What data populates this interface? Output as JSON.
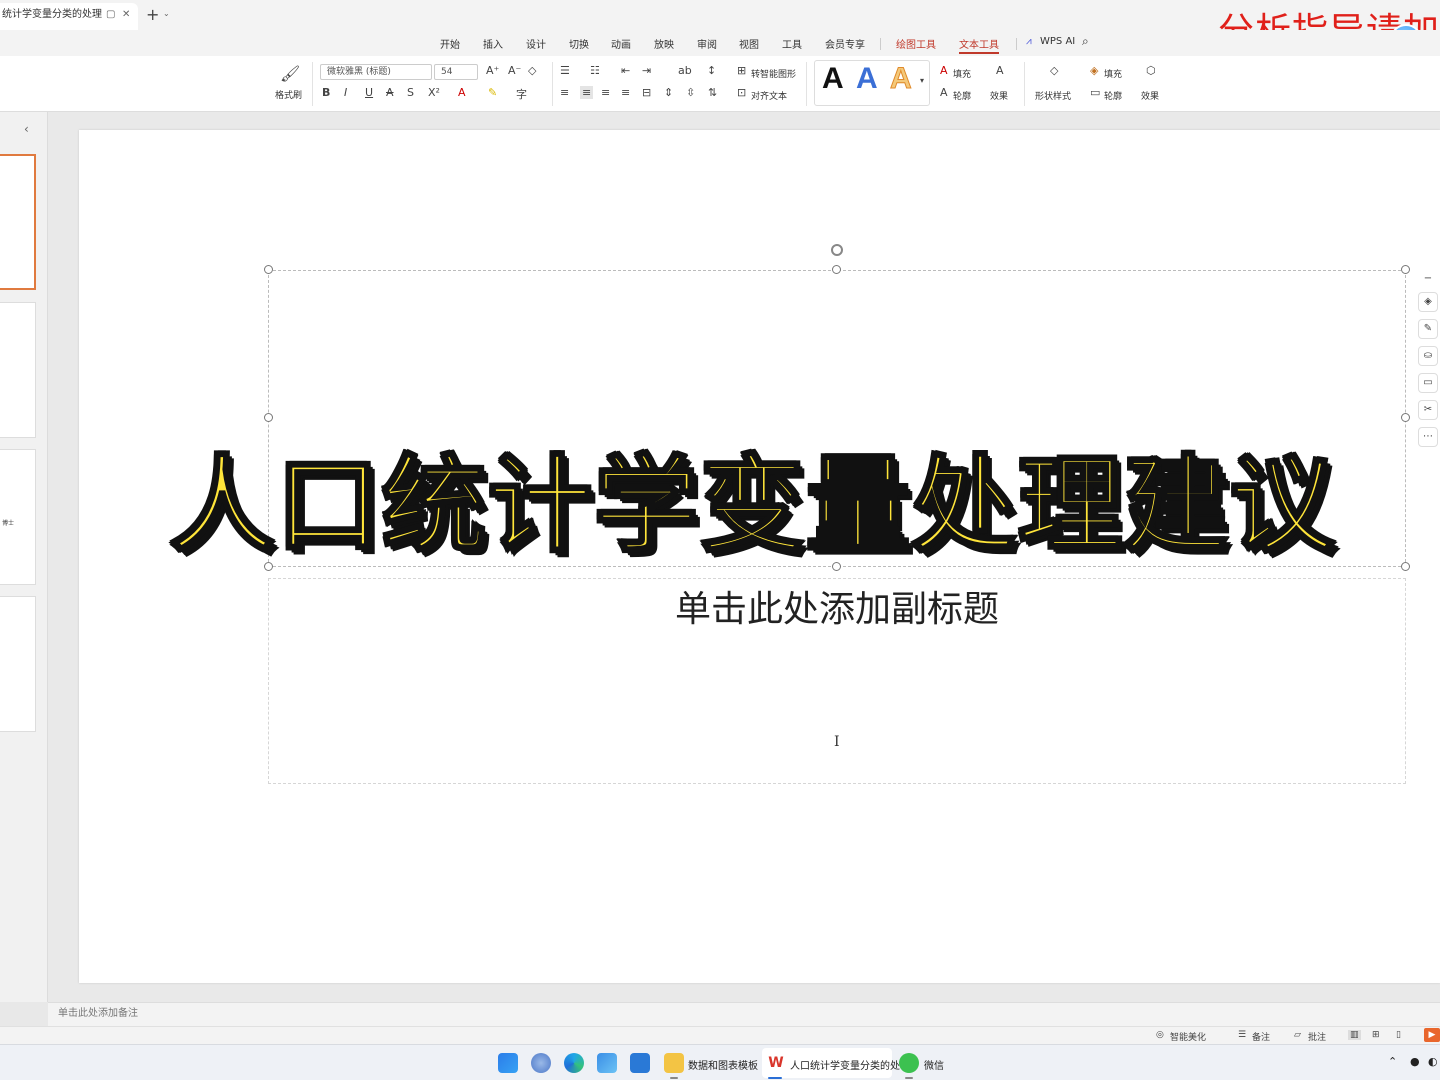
{
  "titlebar": {
    "doc_tab": "统计学变量分类的处理建",
    "new_tab": "+",
    "watermark": "分析指导请加"
  },
  "menu": {
    "items": [
      "开始",
      "插入",
      "设计",
      "切换",
      "动画",
      "放映",
      "审阅",
      "视图",
      "工具",
      "会员专享",
      "绘图工具",
      "文本工具",
      "WPS AI"
    ]
  },
  "ribbon": {
    "format_painter": "格式刷",
    "font_name": "微软雅黑 (标题)",
    "font_size": "54",
    "bold": "B",
    "italic": "I",
    "underline": "U",
    "strike": "S",
    "shadow_s": "S",
    "superscript": "X²",
    "smart_shape": "转智能图形",
    "align_text": "对齐文本",
    "fill1": "填充",
    "outline1": "轮廓",
    "effect1": "效果",
    "shape_style": "形状样式",
    "fill2": "填充",
    "outline2": "轮廓",
    "effect2": "效果",
    "sample_A": "A"
  },
  "slide": {
    "title": "人口统计学变量处理建议",
    "subtitle": "单击此处添加副标题"
  },
  "thumbnails": {
    "slide3_text": "博士"
  },
  "notes": {
    "placeholder": "单击此处添加备注"
  },
  "statusbar": {
    "beautify": "智能美化",
    "notes": "备注",
    "comment": "批注"
  },
  "taskbar": {
    "folder_label": "数据和图表模板",
    "wps_label": "人口统计学变量分类的处",
    "wechat_label": "微信"
  }
}
